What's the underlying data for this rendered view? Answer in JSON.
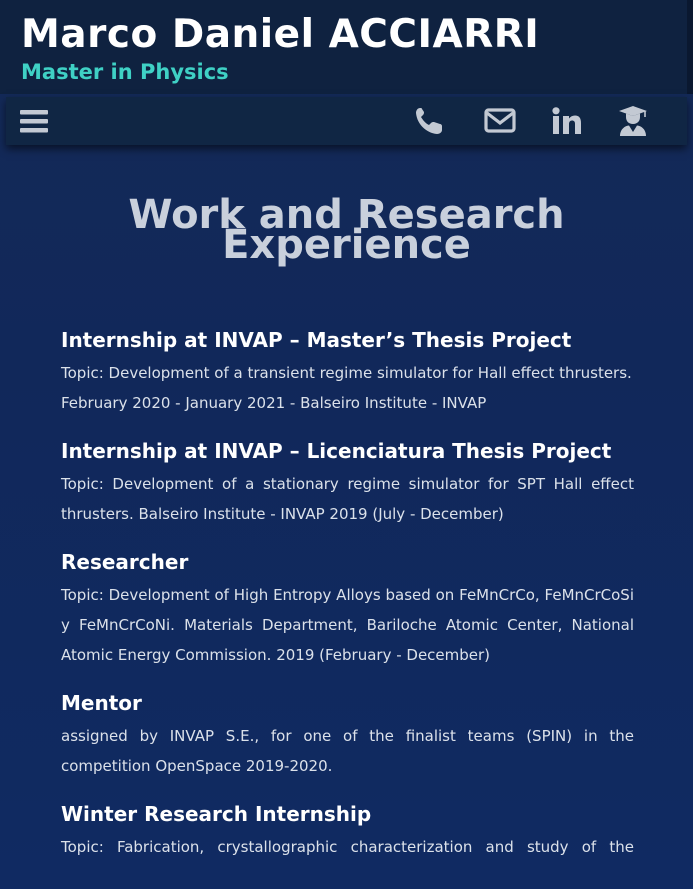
{
  "header": {
    "name": "Marco Daniel ACCIARRI",
    "subtitle": "Master in Physics"
  },
  "nav": {
    "icons": [
      "menu-icon",
      "phone-icon",
      "envelope-icon",
      "linkedin-icon",
      "graduate-icon"
    ],
    "linkedin_text": "in"
  },
  "section": {
    "title_line1": "Work and Research",
    "title_line2": "Experience"
  },
  "entries": [
    {
      "title": "Internship at INVAP – Master’s Thesis Project",
      "lines": [
        "Topic: Development of a transient regime simulator for Hall effect thrusters.",
        "February 2020 - January 2021 - Balseiro Institute - INVAP"
      ]
    },
    {
      "title": "Internship at INVAP – Licenciatura Thesis Project",
      "lines": [
        "Topic: Development of a stationary regime simulator for SPT Hall effect thrusters. Balseiro Institute - INVAP 2019 (July - December)"
      ]
    },
    {
      "title": "Researcher",
      "lines": [
        "Topic: Development of High Entropy Alloys based on FeMnCrCo, FeMnCrCoSi y FeMnCrCoNi. Materials Department, Bariloche Atomic Center, National Atomic Energy Commission. 2019 (February - December)"
      ]
    },
    {
      "title": "Mentor",
      "lines": [
        "assigned by INVAP S.E., for one of the finalist teams (SPIN) in the competition OpenSpace 2019-2020."
      ]
    },
    {
      "title": "Winter Research Internship",
      "lines": [
        "Topic: Fabrication, crystallographic characterization and study of the"
      ]
    }
  ]
}
